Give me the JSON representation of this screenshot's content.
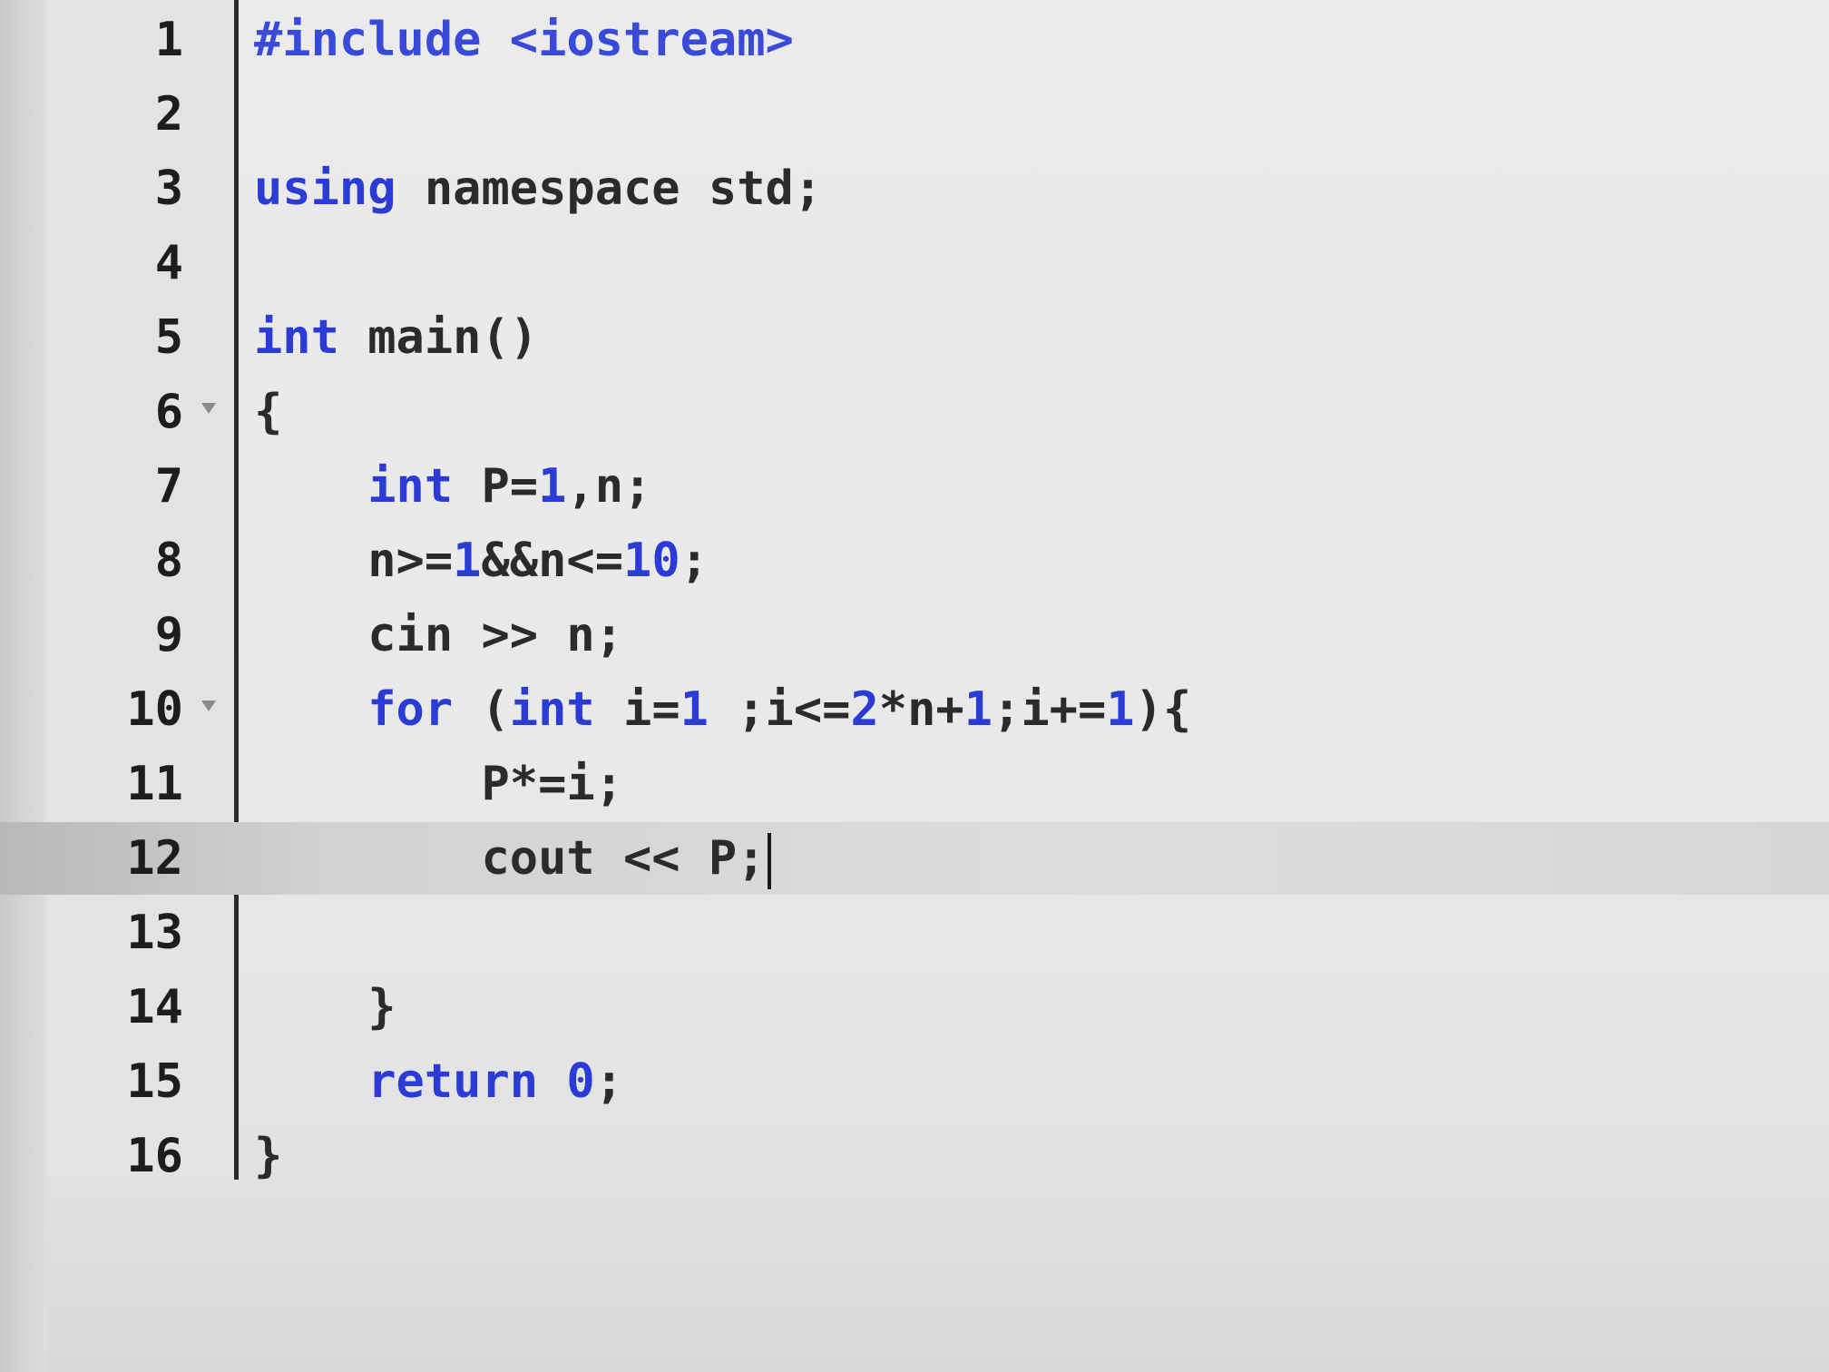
{
  "editor": {
    "lines": [
      {
        "num": "1",
        "tokens": [
          {
            "t": "#include <iostream>",
            "c": "pp"
          }
        ]
      },
      {
        "num": "2",
        "tokens": []
      },
      {
        "num": "3",
        "tokens": [
          {
            "t": "using",
            "c": "kw"
          },
          {
            "t": " namespace std;",
            "c": ""
          }
        ]
      },
      {
        "num": "4",
        "tokens": []
      },
      {
        "num": "5",
        "tokens": [
          {
            "t": "int",
            "c": "kw"
          },
          {
            "t": " main()",
            "c": ""
          }
        ]
      },
      {
        "num": "6",
        "fold": true,
        "tokens": [
          {
            "t": "{",
            "c": ""
          }
        ]
      },
      {
        "num": "7",
        "tokens": [
          {
            "t": "    ",
            "c": ""
          },
          {
            "t": "int",
            "c": "kw"
          },
          {
            "t": " P=",
            "c": ""
          },
          {
            "t": "1",
            "c": "num"
          },
          {
            "t": ",n;",
            "c": ""
          }
        ]
      },
      {
        "num": "8",
        "tokens": [
          {
            "t": "    n>=",
            "c": ""
          },
          {
            "t": "1",
            "c": "num"
          },
          {
            "t": "&&n<=",
            "c": ""
          },
          {
            "t": "10",
            "c": "num"
          },
          {
            "t": ";",
            "c": ""
          }
        ]
      },
      {
        "num": "9",
        "tokens": [
          {
            "t": "    cin >> n;",
            "c": ""
          }
        ]
      },
      {
        "num": "10",
        "fold": true,
        "tokens": [
          {
            "t": "    ",
            "c": ""
          },
          {
            "t": "for",
            "c": "kw"
          },
          {
            "t": " (",
            "c": ""
          },
          {
            "t": "int",
            "c": "kw"
          },
          {
            "t": " i=",
            "c": ""
          },
          {
            "t": "1",
            "c": "num"
          },
          {
            "t": " ;i<=",
            "c": ""
          },
          {
            "t": "2",
            "c": "num"
          },
          {
            "t": "*n+",
            "c": ""
          },
          {
            "t": "1",
            "c": "num"
          },
          {
            "t": ";i+=",
            "c": ""
          },
          {
            "t": "1",
            "c": "num"
          },
          {
            "t": "){",
            "c": ""
          }
        ]
      },
      {
        "num": "11",
        "tokens": [
          {
            "t": "        P*=i;",
            "c": ""
          }
        ]
      },
      {
        "num": "12",
        "active": true,
        "caret": true,
        "tokens": [
          {
            "t": "        cout << P;",
            "c": ""
          }
        ]
      },
      {
        "num": "13",
        "tokens": []
      },
      {
        "num": "14",
        "tokens": [
          {
            "t": "    }",
            "c": ""
          }
        ]
      },
      {
        "num": "15",
        "tokens": [
          {
            "t": "    ",
            "c": ""
          },
          {
            "t": "return",
            "c": "kw"
          },
          {
            "t": " ",
            "c": ""
          },
          {
            "t": "0",
            "c": "num"
          },
          {
            "t": ";",
            "c": ""
          }
        ]
      },
      {
        "num": "16",
        "tokens": [
          {
            "t": "}",
            "c": ""
          }
        ]
      }
    ]
  }
}
